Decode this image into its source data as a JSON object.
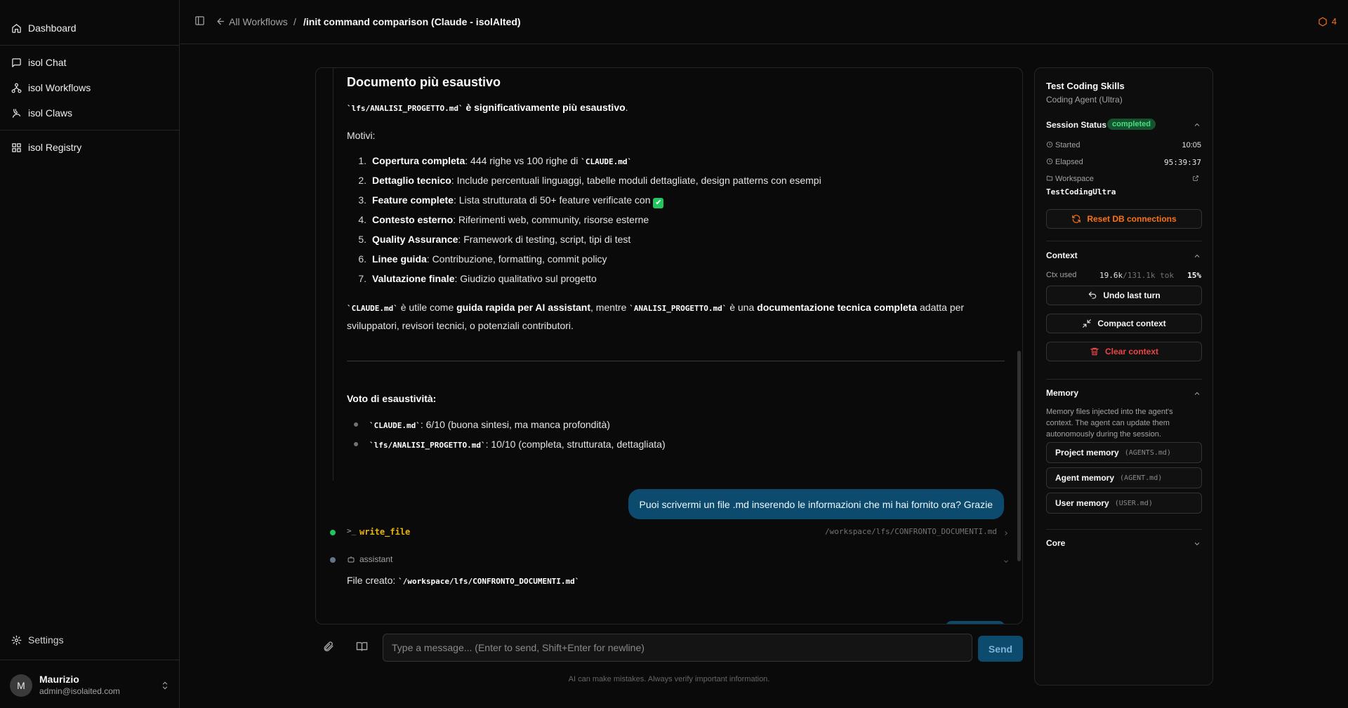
{
  "sidebar": {
    "items": [
      {
        "label": "Dashboard",
        "icon": "home-icon"
      },
      {
        "label": "isol Chat",
        "icon": "chat-icon"
      },
      {
        "label": "isol Workflows",
        "icon": "workflow-icon"
      },
      {
        "label": "isol Claws",
        "icon": "claws-icon"
      },
      {
        "label": "isol Registry",
        "icon": "grid-icon"
      }
    ],
    "settings_label": "Settings",
    "user": {
      "initial": "M",
      "name": "Maurizio",
      "email": "admin@isolaited.com"
    }
  },
  "header": {
    "back_label": "All Workflows",
    "separator": "/",
    "title": "/init command comparison (Claude - isolAIted)",
    "alert_count": "4"
  },
  "chat": {
    "heading": "Documento più esaustivo",
    "p1_code": "`lfs/ANALISI_PROGETTO.md`",
    "p1_text": " è significativamente più esaustivo",
    "p1_end": ".",
    "motivi": "Motivi:",
    "reasons": [
      {
        "n": "1.",
        "title": "Copertura completa",
        "text": ": 444 righe vs 100 righe di ",
        "code": "`CLAUDE.md`"
      },
      {
        "n": "2.",
        "title": "Dettaglio tecnico",
        "text": ": Include percentuali linguaggi, tabelle moduli dettagliate, design patterns con esempi",
        "code": ""
      },
      {
        "n": "3.",
        "title": "Feature complete",
        "text": ": Lista strutturata di 50+ feature verificate con ",
        "code": ""
      },
      {
        "n": "4.",
        "title": "Contesto esterno",
        "text": ": Riferimenti web, community, risorse esterne",
        "code": ""
      },
      {
        "n": "5.",
        "title": "Quality Assurance",
        "text": ": Framework di testing, script, tipi di test",
        "code": ""
      },
      {
        "n": "6.",
        "title": "Linee guida",
        "text": ": Contribuzione, formatting, commit policy",
        "code": ""
      },
      {
        "n": "7.",
        "title": "Valutazione finale",
        "text": ": Giudizio qualitativo sul progetto",
        "code": ""
      }
    ],
    "check_glyph": "✔",
    "summary": {
      "code1": "`CLAUDE.md`",
      "t1": " è utile come ",
      "b1": "guida rapida per AI assistant",
      "t2": ", mentre ",
      "code2": "`ANALISI_PROGETTO.md`",
      "t3": " è una ",
      "b2": "documentazione tecnica completa",
      "t4": " adatta per",
      "line2": "sviluppatori, revisori tecnici, o potenziali contributori."
    },
    "vote_heading": "Voto di esaustività:",
    "votes": [
      {
        "code": "`CLAUDE.md`",
        "text": ": 6/10 (buona sintesi, ma manca profondità)"
      },
      {
        "code": "`lfs/ANALISI_PROGETTO.md`",
        "text": ": 10/10 (completa, strutturata, dettagliata)"
      }
    ],
    "user_message": "Puoi scrivermi un file .md inserendo le informazioni che mi hai fornito ora? Grazie",
    "tool": {
      "prompt": ">_",
      "name": "write_file",
      "path": "/workspace/lfs/CONFRONTO_DOCUMENTI.md"
    },
    "assistant_label": "assistant",
    "file_created_label": "File creato: ",
    "file_created_code": "`/workspace/lfs/CONFRONTO_DOCUMENTI.md`"
  },
  "composer": {
    "placeholder": "Type a message... (Enter to send, Shift+Enter for newline)",
    "send_label": "Send",
    "disclaimer": "AI can make mistakes. Always verify important information."
  },
  "panel": {
    "title": "Test Coding Skills",
    "subtitle": "Coding Agent (Ultra)",
    "session_status_label": "Session Status",
    "status": "completed",
    "started_label": "Started",
    "started_value": "10:05",
    "elapsed_label": "Elapsed",
    "elapsed_value": "95:39:37",
    "workspace_label": "Workspace",
    "workspace_name": "TestCodingUltra",
    "reset_db_label": "Reset DB connections",
    "context_label": "Context",
    "ctx_used_label": "Ctx used",
    "ctx_used": "19.6k",
    "ctx_total": "/131.1k tok",
    "ctx_pct": "15%",
    "undo_label": "Undo last turn",
    "compact_label": "Compact context",
    "clear_label": "Clear context",
    "memory_label": "Memory",
    "memory_desc": "Memory files injected into the agent's context. The agent can update them autonomously during the session.",
    "memory_items": [
      {
        "label": "Project memory",
        "file": "(AGENTS.md)"
      },
      {
        "label": "Agent memory",
        "file": "(AGENT.md)"
      },
      {
        "label": "User memory",
        "file": "(USER.md)"
      }
    ],
    "core_label": "Core"
  },
  "colors": {
    "accent": "#0c4a6e",
    "status_green": "#4ade80",
    "warning_orange": "#f97316",
    "danger_red": "#ef4444",
    "tool_yellow": "#eab308"
  }
}
